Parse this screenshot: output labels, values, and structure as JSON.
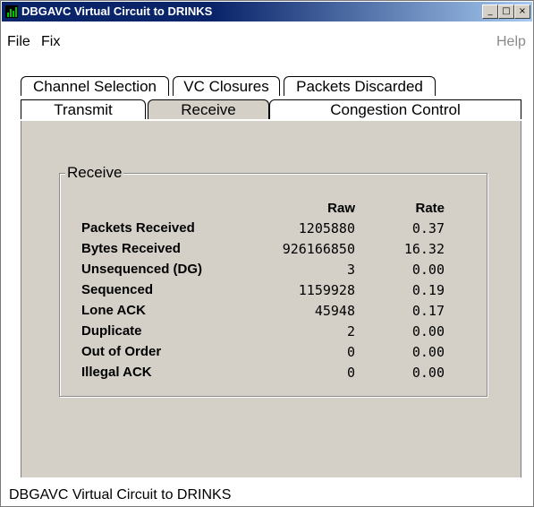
{
  "window": {
    "title": "DBGAVC Virtual Circuit to DRINKS",
    "controls": {
      "minimize": "_",
      "maximize": "□",
      "close": "×"
    }
  },
  "menu": {
    "items": [
      "File",
      "Fix"
    ],
    "help": "Help"
  },
  "tabs": {
    "back_row": [
      "Channel Selection",
      "VC Closures",
      "Packets Discarded"
    ],
    "front_row": [
      "Transmit",
      "Receive",
      "Congestion Control"
    ],
    "active": "Receive"
  },
  "receive_group": {
    "title": "Receive",
    "columns": {
      "raw": "Raw",
      "rate": "Rate"
    },
    "rows": [
      {
        "label": "Packets Received",
        "raw": "1205880",
        "rate": "0.37"
      },
      {
        "label": "Bytes Received",
        "raw": "926166850",
        "rate": "16.32"
      },
      {
        "label": "Unsequenced (DG)",
        "raw": "3",
        "rate": "0.00"
      },
      {
        "label": "Sequenced",
        "raw": "1159928",
        "rate": "0.19"
      },
      {
        "label": "Lone ACK",
        "raw": "45948",
        "rate": "0.17"
      },
      {
        "label": "Duplicate",
        "raw": "2",
        "rate": "0.00"
      },
      {
        "label": "Out of Order",
        "raw": "0",
        "rate": "0.00"
      },
      {
        "label": "Illegal ACK",
        "raw": "0",
        "rate": "0.00"
      }
    ]
  },
  "status": {
    "text": "DBGAVC Virtual Circuit to DRINKS"
  },
  "colors": {
    "titlebar": "#0a246a",
    "panel": "#d4d0c8"
  }
}
